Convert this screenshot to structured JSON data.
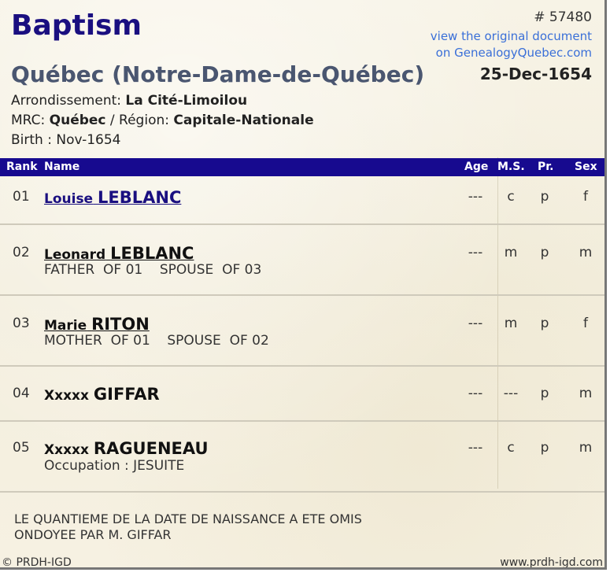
{
  "header": {
    "title": "Baptism",
    "record_number": "# 57480",
    "link_line1": "view the original document",
    "link_line2": "on GenealogyQuebec.com",
    "parish": "Québec (Notre-Dame-de-Québec)",
    "event_date": "25-Dec-1654",
    "arrondissement_label": "Arrondissement:",
    "arrondissement": "La Cité-Limoilou",
    "mrc_label": "MRC:",
    "mrc": "Québec",
    "region_label": "/ Région:",
    "region": "Capitale-Nationale",
    "birth": "Birth : Nov-1654"
  },
  "columns": {
    "rank": "Rank",
    "name": "Name",
    "age": "Age",
    "ms": "M.S.",
    "pr": "Pr.",
    "sex": "Sex"
  },
  "persons": [
    {
      "rank": "01",
      "first": "Louise",
      "last": "LEBLANC",
      "sub": "",
      "age": "---",
      "ms": "c",
      "pr": "p",
      "sex": "f"
    },
    {
      "rank": "02",
      "first": "Leonard",
      "last": "LEBLANC",
      "sub": "FATHER  OF 01    SPOUSE  OF 03",
      "age": "---",
      "ms": "m",
      "pr": "p",
      "sex": "m"
    },
    {
      "rank": "03",
      "first": "Marie",
      "last": "RITON",
      "sub": "MOTHER  OF 01    SPOUSE  OF 02",
      "age": "---",
      "ms": "m",
      "pr": "p",
      "sex": "f"
    },
    {
      "rank": "04",
      "first": "Xxxxx",
      "last": "GIFFAR",
      "sub": "",
      "age": "---",
      "ms": "---",
      "pr": "p",
      "sex": "m"
    },
    {
      "rank": "05",
      "first": "Xxxxx",
      "last": "RAGUENEAU",
      "sub": "Occupation : JESUITE",
      "age": "---",
      "ms": "c",
      "pr": "p",
      "sex": "m"
    }
  ],
  "notes": {
    "line1": "LE QUANTIEME DE LA DATE DE NAISSANCE A ETE OMIS",
    "line2": "ONDOYEE PAR M. GIFFAR"
  },
  "footer": {
    "copyright": "© PRDH-IGD",
    "site": "www.prdh-igd.com"
  }
}
